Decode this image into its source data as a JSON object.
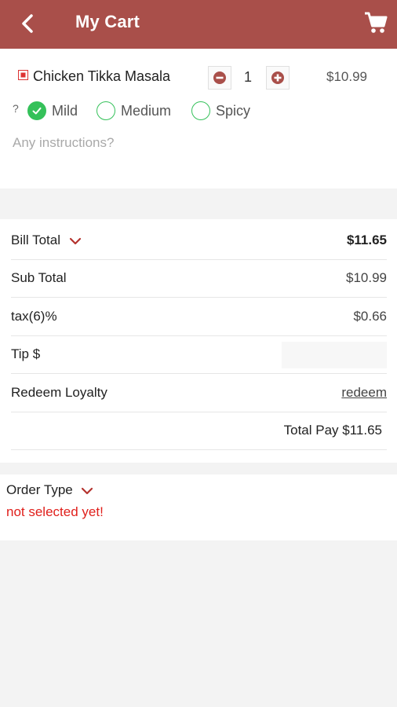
{
  "header": {
    "title": "My Cart",
    "accent_color": "#a94f4a",
    "back_icon": "back-chevron-icon",
    "cart_icon": "cart-icon"
  },
  "cart_item": {
    "name": "Chicken Tikka Masala",
    "quantity": "1",
    "price": "$10.99",
    "spice_prompt": "?",
    "spice_options": [
      {
        "label": "Mild",
        "selected": true
      },
      {
        "label": "Medium",
        "selected": false
      },
      {
        "label": "Spicy",
        "selected": false
      }
    ],
    "instructions_placeholder": "Any instructions?",
    "instructions_value": ""
  },
  "bill": {
    "bill_total_label": "Bill Total",
    "bill_total_value": "$11.65",
    "sub_total_label": "Sub Total",
    "sub_total_value": "$10.99",
    "tax_label": "tax(6)%",
    "tax_value": "$0.66",
    "tip_label": "Tip $",
    "tip_value": "",
    "redeem_label": "Redeem Loyalty",
    "redeem_link": "redeem",
    "total_pay": "Total Pay $11.65"
  },
  "order_type": {
    "label": "Order Type",
    "status": "not selected yet!",
    "status_color": "#e0201c"
  },
  "colors": {
    "radio_green": "#35c15a",
    "link_blue": "#2b7bd6"
  }
}
